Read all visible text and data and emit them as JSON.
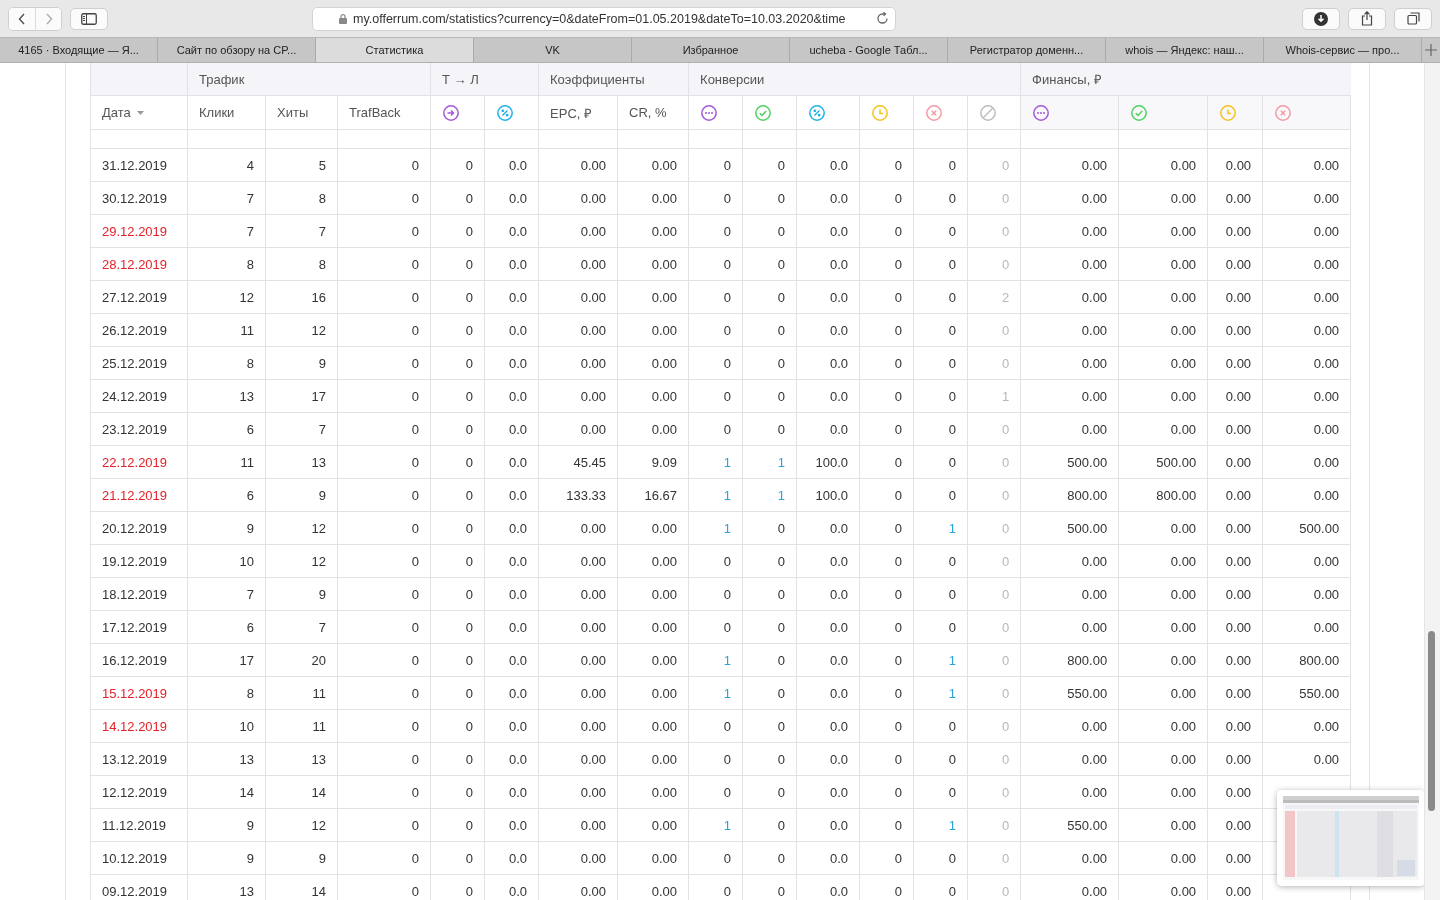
{
  "browser": {
    "url": "my.offerrum.com/statistics?currency=0&dateFrom=01.05.2019&dateTo=10.03.2020&time",
    "tabs": [
      {
        "label": "4165 · Входящие — Я...",
        "selected": false
      },
      {
        "label": "Сайт по обзору на CP...",
        "selected": false
      },
      {
        "label": "Статистика",
        "selected": true
      },
      {
        "label": "VK",
        "selected": false
      },
      {
        "label": "Избранное",
        "selected": false
      },
      {
        "label": "ucheba - Google Табл...",
        "selected": false
      },
      {
        "label": "Регистратор доменн...",
        "selected": false
      },
      {
        "label": "whois — Яндекс: наш...",
        "selected": false
      },
      {
        "label": "Whois-сервис — про...",
        "selected": false
      }
    ]
  },
  "table": {
    "groups": [
      {
        "label": "Трафик"
      },
      {
        "label": "Т → Л"
      },
      {
        "label": "Коэффициенты"
      },
      {
        "label": "Конверсии"
      },
      {
        "label": "Финансы, ₽"
      }
    ],
    "columns": [
      {
        "kind": "text",
        "label": "Дата",
        "sorted": true
      },
      {
        "kind": "text",
        "label": "Клики",
        "sorted": false
      },
      {
        "kind": "text",
        "label": "Хиты",
        "sorted": false
      },
      {
        "kind": "text",
        "label": "TrafBack",
        "sorted": false
      },
      {
        "kind": "arrow"
      },
      {
        "kind": "percent"
      },
      {
        "kind": "text",
        "label": "EPC, ₽",
        "sorted": false
      },
      {
        "kind": "text",
        "label": "CR, %",
        "sorted": false
      },
      {
        "kind": "dots"
      },
      {
        "kind": "check"
      },
      {
        "kind": "percent"
      },
      {
        "kind": "clock"
      },
      {
        "kind": "cross"
      },
      {
        "kind": "blocked"
      },
      {
        "kind": "dots"
      },
      {
        "kind": "check"
      },
      {
        "kind": "clock"
      },
      {
        "kind": "cross"
      }
    ],
    "rows": [
      {
        "weekend": false,
        "cells": [
          "31.12.2019",
          "4",
          "5",
          "0",
          "0",
          "0.0",
          "0.00",
          "0.00",
          "0",
          "0",
          "0.0",
          "0",
          "0",
          "0",
          "0.00",
          "0.00",
          "0.00",
          "0.00"
        ],
        "linked": [
          false,
          false,
          false,
          false,
          false,
          false
        ]
      },
      {
        "weekend": false,
        "cells": [
          "30.12.2019",
          "7",
          "8",
          "0",
          "0",
          "0.0",
          "0.00",
          "0.00",
          "0",
          "0",
          "0.0",
          "0",
          "0",
          "0",
          "0.00",
          "0.00",
          "0.00",
          "0.00"
        ],
        "linked": [
          false,
          false,
          false,
          false,
          false,
          false
        ]
      },
      {
        "weekend": true,
        "cells": [
          "29.12.2019",
          "7",
          "7",
          "0",
          "0",
          "0.0",
          "0.00",
          "0.00",
          "0",
          "0",
          "0.0",
          "0",
          "0",
          "0",
          "0.00",
          "0.00",
          "0.00",
          "0.00"
        ],
        "linked": [
          false,
          false,
          false,
          false,
          false,
          false
        ]
      },
      {
        "weekend": true,
        "cells": [
          "28.12.2019",
          "8",
          "8",
          "0",
          "0",
          "0.0",
          "0.00",
          "0.00",
          "0",
          "0",
          "0.0",
          "0",
          "0",
          "0",
          "0.00",
          "0.00",
          "0.00",
          "0.00"
        ],
        "linked": [
          false,
          false,
          false,
          false,
          false,
          false
        ]
      },
      {
        "weekend": false,
        "cells": [
          "27.12.2019",
          "12",
          "16",
          "0",
          "0",
          "0.0",
          "0.00",
          "0.00",
          "0",
          "0",
          "0.0",
          "0",
          "0",
          "2",
          "0.00",
          "0.00",
          "0.00",
          "0.00"
        ],
        "linked": [
          false,
          false,
          false,
          false,
          false,
          false
        ]
      },
      {
        "weekend": false,
        "cells": [
          "26.12.2019",
          "11",
          "12",
          "0",
          "0",
          "0.0",
          "0.00",
          "0.00",
          "0",
          "0",
          "0.0",
          "0",
          "0",
          "0",
          "0.00",
          "0.00",
          "0.00",
          "0.00"
        ],
        "linked": [
          false,
          false,
          false,
          false,
          false,
          false
        ]
      },
      {
        "weekend": false,
        "cells": [
          "25.12.2019",
          "8",
          "9",
          "0",
          "0",
          "0.0",
          "0.00",
          "0.00",
          "0",
          "0",
          "0.0",
          "0",
          "0",
          "0",
          "0.00",
          "0.00",
          "0.00",
          "0.00"
        ],
        "linked": [
          false,
          false,
          false,
          false,
          false,
          false
        ]
      },
      {
        "weekend": false,
        "cells": [
          "24.12.2019",
          "13",
          "17",
          "0",
          "0",
          "0.0",
          "0.00",
          "0.00",
          "0",
          "0",
          "0.0",
          "0",
          "0",
          "1",
          "0.00",
          "0.00",
          "0.00",
          "0.00"
        ],
        "linked": [
          false,
          false,
          false,
          false,
          false,
          false
        ]
      },
      {
        "weekend": false,
        "cells": [
          "23.12.2019",
          "6",
          "7",
          "0",
          "0",
          "0.0",
          "0.00",
          "0.00",
          "0",
          "0",
          "0.0",
          "0",
          "0",
          "0",
          "0.00",
          "0.00",
          "0.00",
          "0.00"
        ],
        "linked": [
          false,
          false,
          false,
          false,
          false,
          false
        ]
      },
      {
        "weekend": true,
        "cells": [
          "22.12.2019",
          "11",
          "13",
          "0",
          "0",
          "0.0",
          "45.45",
          "9.09",
          "1",
          "1",
          "100.0",
          "0",
          "0",
          "0",
          "500.00",
          "500.00",
          "0.00",
          "0.00"
        ],
        "linked": [
          true,
          true,
          false,
          false,
          false,
          false
        ]
      },
      {
        "weekend": true,
        "cells": [
          "21.12.2019",
          "6",
          "9",
          "0",
          "0",
          "0.0",
          "133.33",
          "16.67",
          "1",
          "1",
          "100.0",
          "0",
          "0",
          "0",
          "800.00",
          "800.00",
          "0.00",
          "0.00"
        ],
        "linked": [
          true,
          true,
          false,
          false,
          false,
          false
        ]
      },
      {
        "weekend": false,
        "cells": [
          "20.12.2019",
          "9",
          "12",
          "0",
          "0",
          "0.0",
          "0.00",
          "0.00",
          "1",
          "0",
          "0.0",
          "0",
          "1",
          "0",
          "500.00",
          "0.00",
          "0.00",
          "500.00"
        ],
        "linked": [
          true,
          false,
          false,
          false,
          true,
          false
        ]
      },
      {
        "weekend": false,
        "cells": [
          "19.12.2019",
          "10",
          "12",
          "0",
          "0",
          "0.0",
          "0.00",
          "0.00",
          "0",
          "0",
          "0.0",
          "0",
          "0",
          "0",
          "0.00",
          "0.00",
          "0.00",
          "0.00"
        ],
        "linked": [
          false,
          false,
          false,
          false,
          false,
          false
        ]
      },
      {
        "weekend": false,
        "cells": [
          "18.12.2019",
          "7",
          "9",
          "0",
          "0",
          "0.0",
          "0.00",
          "0.00",
          "0",
          "0",
          "0.0",
          "0",
          "0",
          "0",
          "0.00",
          "0.00",
          "0.00",
          "0.00"
        ],
        "linked": [
          false,
          false,
          false,
          false,
          false,
          false
        ]
      },
      {
        "weekend": false,
        "cells": [
          "17.12.2019",
          "6",
          "7",
          "0",
          "0",
          "0.0",
          "0.00",
          "0.00",
          "0",
          "0",
          "0.0",
          "0",
          "0",
          "0",
          "0.00",
          "0.00",
          "0.00",
          "0.00"
        ],
        "linked": [
          false,
          false,
          false,
          false,
          false,
          false
        ]
      },
      {
        "weekend": false,
        "cells": [
          "16.12.2019",
          "17",
          "20",
          "0",
          "0",
          "0.0",
          "0.00",
          "0.00",
          "1",
          "0",
          "0.0",
          "0",
          "1",
          "0",
          "800.00",
          "0.00",
          "0.00",
          "800.00"
        ],
        "linked": [
          true,
          false,
          false,
          false,
          true,
          false
        ]
      },
      {
        "weekend": true,
        "cells": [
          "15.12.2019",
          "8",
          "11",
          "0",
          "0",
          "0.0",
          "0.00",
          "0.00",
          "1",
          "0",
          "0.0",
          "0",
          "1",
          "0",
          "550.00",
          "0.00",
          "0.00",
          "550.00"
        ],
        "linked": [
          true,
          false,
          false,
          false,
          true,
          false
        ]
      },
      {
        "weekend": true,
        "cells": [
          "14.12.2019",
          "10",
          "11",
          "0",
          "0",
          "0.0",
          "0.00",
          "0.00",
          "0",
          "0",
          "0.0",
          "0",
          "0",
          "0",
          "0.00",
          "0.00",
          "0.00",
          "0.00"
        ],
        "linked": [
          false,
          false,
          false,
          false,
          false,
          false
        ]
      },
      {
        "weekend": false,
        "cells": [
          "13.12.2019",
          "13",
          "13",
          "0",
          "0",
          "0.0",
          "0.00",
          "0.00",
          "0",
          "0",
          "0.0",
          "0",
          "0",
          "0",
          "0.00",
          "0.00",
          "0.00",
          "0.00"
        ],
        "linked": [
          false,
          false,
          false,
          false,
          false,
          false
        ]
      },
      {
        "weekend": false,
        "cells": [
          "12.12.2019",
          "14",
          "14",
          "0",
          "0",
          "0.0",
          "0.00",
          "0.00",
          "0",
          "0",
          "0.0",
          "0",
          "0",
          "0",
          "0.00",
          "0.00",
          "0.00"
        ],
        "linked": [
          false,
          false,
          false,
          false,
          false,
          false
        ]
      },
      {
        "weekend": false,
        "cells": [
          "11.12.2019",
          "9",
          "12",
          "0",
          "0",
          "0.0",
          "0.00",
          "0.00",
          "1",
          "0",
          "0.0",
          "0",
          "1",
          "0",
          "550.00",
          "0.00",
          "0.00"
        ],
        "linked": [
          true,
          false,
          false,
          false,
          true,
          false
        ]
      },
      {
        "weekend": false,
        "cells": [
          "10.12.2019",
          "9",
          "9",
          "0",
          "0",
          "0.0",
          "0.00",
          "0.00",
          "0",
          "0",
          "0.0",
          "0",
          "0",
          "0",
          "0.00",
          "0.00",
          "0.00"
        ],
        "linked": [
          false,
          false,
          false,
          false,
          false,
          false
        ]
      },
      {
        "weekend": false,
        "cells": [
          "09.12.2019",
          "13",
          "14",
          "0",
          "0",
          "0.0",
          "0.00",
          "0.00",
          "0",
          "0",
          "0.0",
          "0",
          "0",
          "0",
          "0.00",
          "0.00",
          "0.00"
        ],
        "linked": [
          false,
          false,
          false,
          false,
          false,
          false
        ]
      }
    ]
  }
}
